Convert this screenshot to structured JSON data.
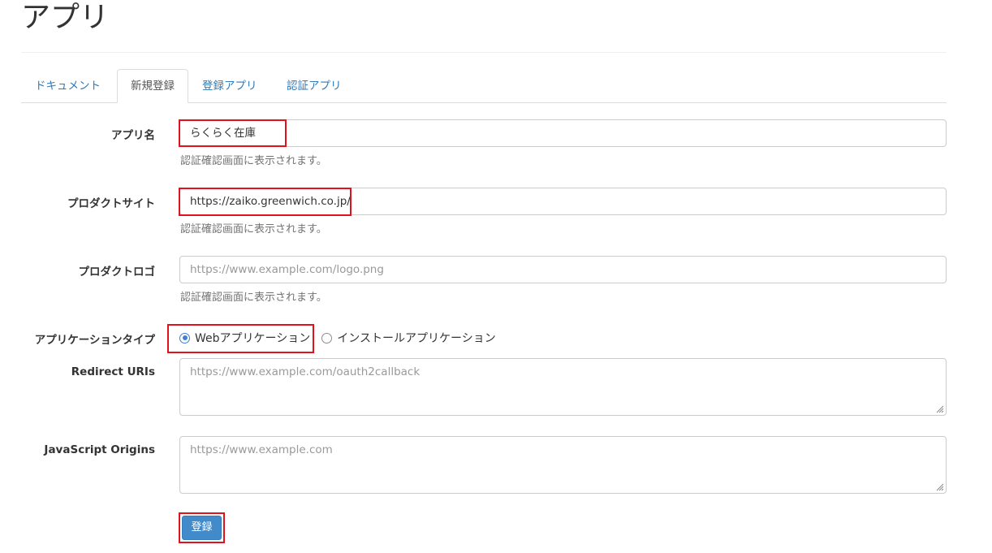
{
  "page": {
    "title": "アプリ"
  },
  "tabs": [
    {
      "label": "ドキュメント",
      "active": false
    },
    {
      "label": "新規登録",
      "active": true
    },
    {
      "label": "登録アプリ",
      "active": false
    },
    {
      "label": "認証アプリ",
      "active": false
    }
  ],
  "form": {
    "app_name": {
      "label": "アプリ名",
      "value": "らくらく在庫",
      "help": "認証確認画面に表示されます。"
    },
    "product_site": {
      "label": "プロダクトサイト",
      "value": "https://zaiko.greenwich.co.jp/",
      "help": "認証確認画面に表示されます。"
    },
    "product_logo": {
      "label": "プロダクトロゴ",
      "value": "",
      "placeholder": "https://www.example.com/logo.png",
      "help": "認証確認画面に表示されます。"
    },
    "app_type": {
      "label": "アプリケーションタイプ",
      "options": [
        {
          "label": "Webアプリケーション",
          "checked": true
        },
        {
          "label": "インストールアプリケーション",
          "checked": false
        }
      ]
    },
    "redirect_uris": {
      "label": "Redirect URIs",
      "value": "",
      "placeholder": "https://www.example.com/oauth2callback"
    },
    "js_origins": {
      "label": "JavaScript Origins",
      "value": "",
      "placeholder": "https://www.example.com"
    },
    "submit_label": "登録"
  },
  "colors": {
    "link": "#337ab7",
    "primary_button": "#428bca",
    "highlight": "#e0121e",
    "radio_checked": "#3b7fd6"
  }
}
